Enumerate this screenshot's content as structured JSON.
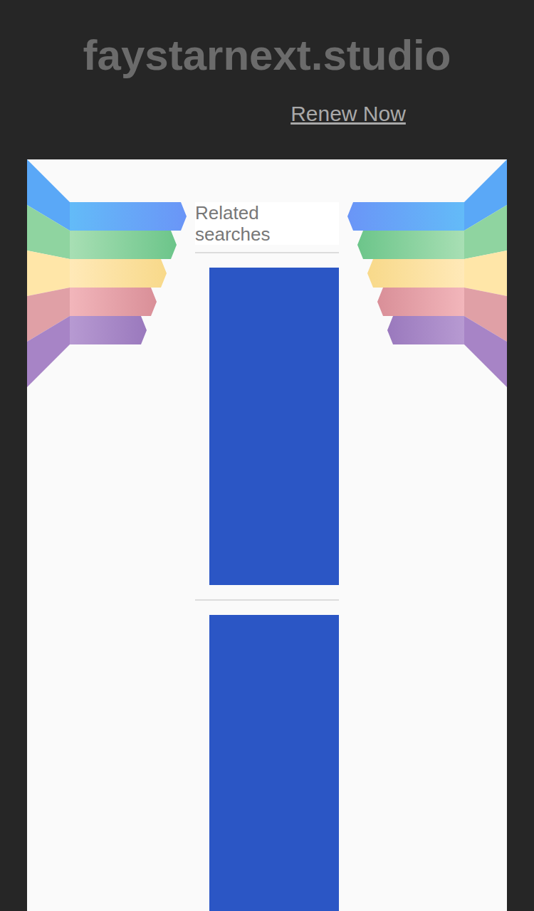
{
  "domain": "faystarnext.studio",
  "renew_link": "Renew Now",
  "related": {
    "heading": "Related searches"
  }
}
